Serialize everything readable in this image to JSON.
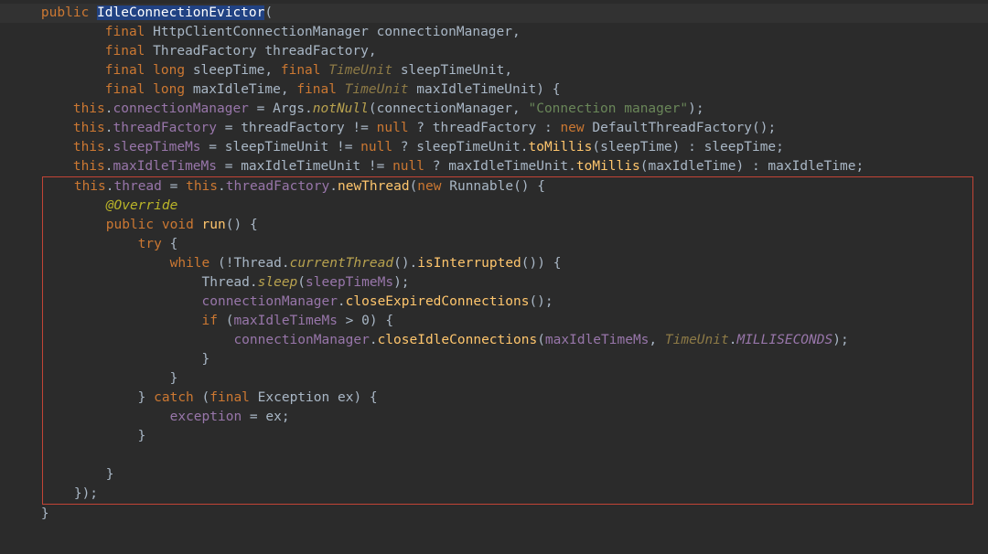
{
  "code": {
    "kw_public": "public",
    "kw_final": "final",
    "kw_long": "long",
    "kw_this": "this",
    "kw_new": "new",
    "kw_null": "null",
    "kw_void": "void",
    "kw_try": "try",
    "kw_while": "while",
    "kw_if": "if",
    "kw_catch": "catch",
    "className": "IdleConnectionEvictor",
    "type_HttpClientConnectionManager": "HttpClientConnectionManager",
    "type_ThreadFactory": "ThreadFactory",
    "type_TimeUnit": "TimeUnit",
    "type_Args": "Args",
    "type_DefaultThreadFactory": "DefaultThreadFactory",
    "type_Runnable": "Runnable",
    "type_Thread": "Thread",
    "type_Exception": "Exception",
    "param_connectionManager": "connectionManager",
    "param_threadFactory": "threadFactory",
    "param_sleepTime": "sleepTime",
    "param_sleepTimeUnit": "sleepTimeUnit",
    "param_maxIdleTime": "maxIdleTime",
    "param_maxIdleTimeUnit": "maxIdleTimeUnit",
    "field_connectionManager": "connectionManager",
    "field_threadFactory": "threadFactory",
    "field_sleepTimeMs": "sleepTimeMs",
    "field_maxIdleTimeMs": "maxIdleTimeMs",
    "field_thread": "thread",
    "field_exception": "exception",
    "method_notNull": "notNull",
    "method_toMillis": "toMillis",
    "method_newThread": "newThread",
    "method_run": "run",
    "method_currentThread": "currentThread",
    "method_isInterrupted": "isInterrupted",
    "method_sleep": "sleep",
    "method_closeExpiredConnections": "closeExpiredConnections",
    "method_closeIdleConnections": "closeIdleConnections",
    "str_connection_manager": "\"Connection manager\"",
    "ann_Override": "@Override",
    "var_ex": "ex",
    "const_MILLISECONDS": "MILLISECONDS",
    "num_zero": "0"
  }
}
